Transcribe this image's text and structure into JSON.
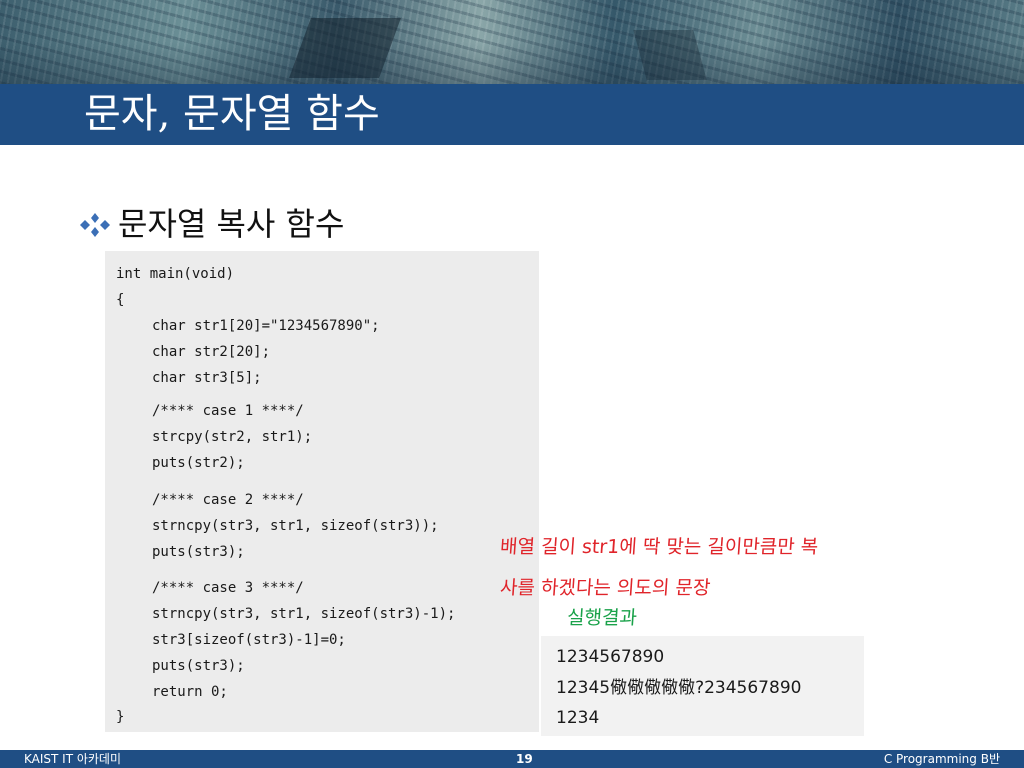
{
  "slide": {
    "title": "문자, 문자열 함수",
    "bullet_icon": "four-diamond-bullet-icon",
    "bullet_text": "문자열 복사 함수"
  },
  "code": {
    "lines": [
      "int main(void)",
      "{",
      "char str1[20]=\"1234567890\";",
      "char str2[20];",
      "char str3[5];",
      "/**** case 1 ****/",
      "strcpy(str2, str1);",
      "puts(str2);",
      "/**** case 2 ****/",
      "strncpy(str3, str1, sizeof(str3));",
      "puts(str3);",
      "/**** case 3 ****/",
      "strncpy(str3, str1, sizeof(str3)-1);",
      "str3[sizeof(str3)-1]=0;",
      "puts(str3);",
      "return 0;",
      "}"
    ]
  },
  "annotations": {
    "red_line1": "배열 길이 str1에 딱 맞는 길이만큼만 복",
    "red_line2": "사를 하겠다는 의도의 문장",
    "green": "실행결과"
  },
  "output": {
    "lines": [
      "1234567890",
      "12345儆儆儆儆儆?234567890",
      "1234"
    ]
  },
  "footer": {
    "left": "KAIST IT 아카데미",
    "page": "19",
    "right": "C Programming B반"
  },
  "colors": {
    "title_bar": "#1f4e84",
    "bullet": "#3b6fb6",
    "annotation_red": "#e0242a",
    "annotation_green": "#1aa24a"
  }
}
